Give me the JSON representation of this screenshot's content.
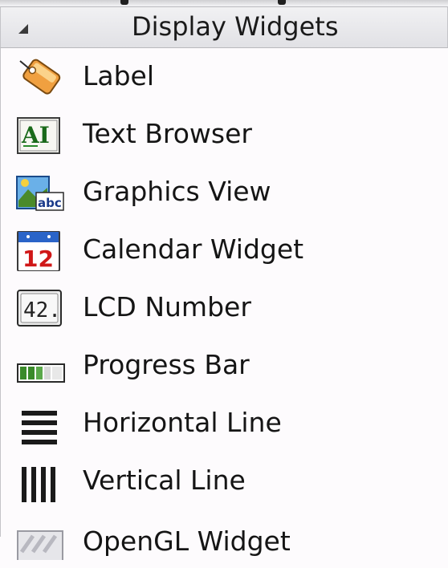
{
  "panel": {
    "title": "Display Widgets",
    "collapse_icon": "collapse-triangle-icon"
  },
  "widgets": [
    {
      "label": "Label",
      "icon": "label-icon"
    },
    {
      "label": "Text Browser",
      "icon": "text-browser-icon"
    },
    {
      "label": "Graphics View",
      "icon": "graphics-view-icon"
    },
    {
      "label": "Calendar Widget",
      "icon": "calendar-widget-icon"
    },
    {
      "label": "LCD Number",
      "icon": "lcd-number-icon"
    },
    {
      "label": "Progress Bar",
      "icon": "progress-bar-icon"
    },
    {
      "label": "Horizontal Line",
      "icon": "horizontal-line-icon"
    },
    {
      "label": "Vertical Line",
      "icon": "vertical-line-icon"
    },
    {
      "label": "OpenGL Widget",
      "icon": "opengl-widget-icon"
    }
  ],
  "icon_text": {
    "text_browser": "AI",
    "calendar_day": "12",
    "lcd_value": "42."
  },
  "colors": {
    "label_tag": "#f0a040",
    "calendar_band": "#2a64c8",
    "calendar_day": "#d01818",
    "progress_fill": "#3a8a2a"
  }
}
